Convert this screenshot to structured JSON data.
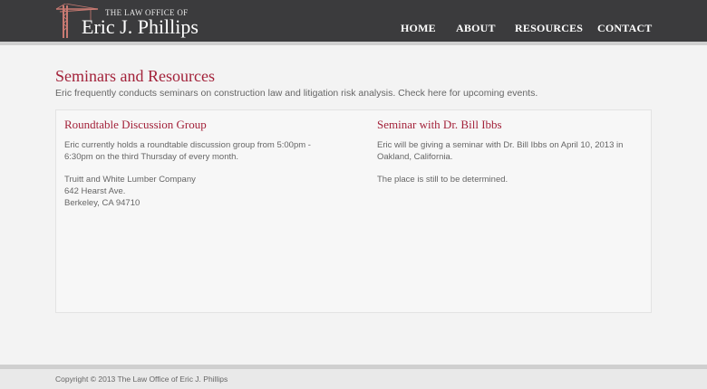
{
  "header": {
    "logo_top": "THE LAW OFFICE OF",
    "logo_name": "Eric J. Phillips",
    "nav": [
      "HOME",
      "ABOUT",
      "RESOURCES",
      "CONTACT"
    ]
  },
  "main": {
    "title": "Seminars and Resources",
    "subtitle": "Eric frequently conducts seminars on construction law and litigation risk analysis. Check here for upcoming events.",
    "left": {
      "heading": "Roundtable Discussion Group",
      "p1": "Eric currently holds a roundtable discussion group from 5:00pm - 6:30pm on the third Thursday of every month.",
      "addr1": "Truitt and White Lumber Company",
      "addr2": "642 Hearst Ave.",
      "addr3": "Berkeley, CA 94710"
    },
    "right": {
      "heading": "Seminar with Dr. Bill Ibbs",
      "p1": "Eric will be giving a seminar with Dr. Bill Ibbs on April 10, 2013 in Oakland, California.",
      "p2": "The place is still to be determined."
    }
  },
  "footer": {
    "copyright": "Copyright © 2013 The Law Office of Eric J. Phillips"
  },
  "colors": {
    "header_bg": "#3b3b3d",
    "accent": "#a3223a",
    "page_bg": "#f3f3f3"
  },
  "icons": [
    "crane-logo-icon"
  ]
}
